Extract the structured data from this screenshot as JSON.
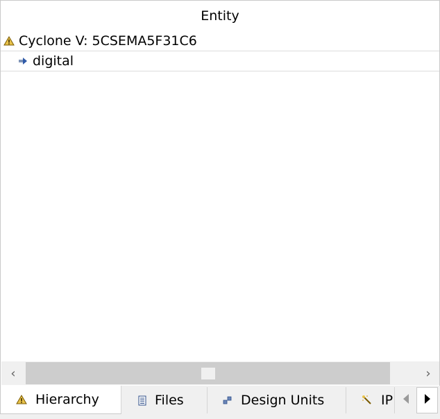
{
  "tree": {
    "column_header": "Entity",
    "device_row": {
      "label": "Cyclone V: 5CSEMA5F31C6",
      "icon": "warning-chip-icon"
    },
    "entity_row": {
      "label": "digital",
      "icon": "entity-arrow-icon"
    }
  },
  "scrollbar": {
    "left_arrow": "‹",
    "right_arrow": "›"
  },
  "tabs": [
    {
      "label": "Hierarchy",
      "icon": "hierarchy-icon",
      "active": true
    },
    {
      "label": "Files",
      "icon": "file-icon",
      "active": false
    },
    {
      "label": "Design Units",
      "icon": "design-units-icon",
      "active": false
    },
    {
      "label": "IP",
      "icon": "ip-wand-icon",
      "active": false
    }
  ],
  "colors": {
    "warning_icon": "#d4a017",
    "icon_blue": "#2f5aa8"
  }
}
